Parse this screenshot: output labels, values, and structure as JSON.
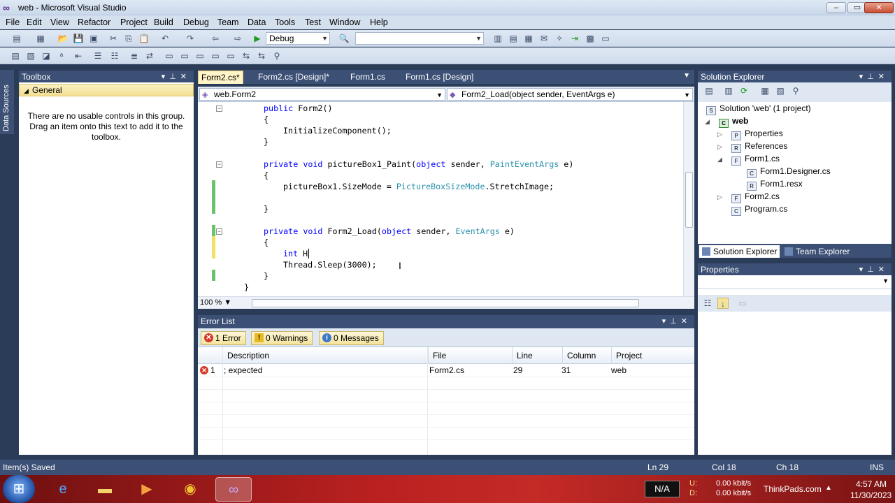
{
  "window": {
    "title": "web - Microsoft Visual Studio"
  },
  "menu": [
    "File",
    "Edit",
    "View",
    "Refactor",
    "Project",
    "Build",
    "Debug",
    "Team",
    "Data",
    "Tools",
    "Test",
    "Window",
    "Help"
  ],
  "toolbar": {
    "config": "Debug",
    "platform": ""
  },
  "sidetab": {
    "label": "Data Sources"
  },
  "toolbox": {
    "title": "Toolbox",
    "group": "General",
    "message": "There are no usable controls in this group. Drag an item onto this text to add it to the toolbox."
  },
  "editor": {
    "tabs": [
      "Form2.cs*",
      "Form2.cs [Design]*",
      "Form1.cs",
      "Form1.cs [Design]"
    ],
    "nav_class": "web.Form2",
    "nav_member": "Form2_Load(object sender, EventArgs e)",
    "zoom": "100 %",
    "lines": {
      "l1a": "public",
      "l1b": " Form2()",
      "l2": "{",
      "l3": "InitializeComponent();",
      "l4": "}",
      "l5a": "private",
      "l5b": " ",
      "l5c": "void",
      "l5d": " pictureBox1_Paint(",
      "l5e": "object",
      "l5f": " sender, ",
      "l5g": "PaintEventArgs",
      "l5h": " e)",
      "l6": "{",
      "l7a": "pictureBox1.SizeMode = ",
      "l7b": "PictureBoxSizeMode",
      "l7c": ".StretchImage;",
      "l8": "}",
      "l9a": "private",
      "l9b": " ",
      "l9c": "void",
      "l9d": " Form2_Load(",
      "l9e": "object",
      "l9f": " sender, ",
      "l9g": "EventArgs",
      "l9h": " e)",
      "l10": "{",
      "l11a": "int",
      "l11b": " H",
      "l12": "Thread.Sleep(3000);",
      "l13": "}",
      "l14": "}"
    }
  },
  "errorlist": {
    "title": "Error List",
    "errors_btn": "1 Error",
    "warnings_btn": "0 Warnings",
    "messages_btn": "0 Messages",
    "columns": {
      "description": "Description",
      "file": "File",
      "line": "Line",
      "column": "Column",
      "project": "Project"
    },
    "rows": [
      {
        "num": "1",
        "description": "; expected",
        "file": "Form2.cs",
        "line": "29",
        "column": "31",
        "project": "web"
      }
    ]
  },
  "solution_explorer": {
    "title": "Solution Explorer",
    "items": [
      "Solution 'web' (1 project)",
      "web",
      "Properties",
      "References",
      "Form1.cs",
      "Form1.Designer.cs",
      "Form1.resx",
      "Form2.cs",
      "Program.cs"
    ],
    "tab_solution": "Solution Explorer",
    "tab_team": "Team Explorer"
  },
  "properties": {
    "title": "Properties"
  },
  "status": {
    "message": "Item(s) Saved",
    "ln": "Ln 29",
    "col": "Col 18",
    "ch": "Ch 18",
    "mode": "INS"
  },
  "taskbar": {
    "na": "N/A",
    "u_label": "U:",
    "d_label": "D:",
    "up_rate": "0.00 kbit/s",
    "down_rate": "0.00 kbit/s",
    "watermark": "ThinkPads.com",
    "time": "4:57 AM",
    "date": "11/30/2023"
  },
  "colors": {
    "chrome": "#3c5075",
    "accent_tab": "#fff5c8",
    "keyword": "#0000ff",
    "type": "#2b91af",
    "error": "#d43a2a"
  }
}
